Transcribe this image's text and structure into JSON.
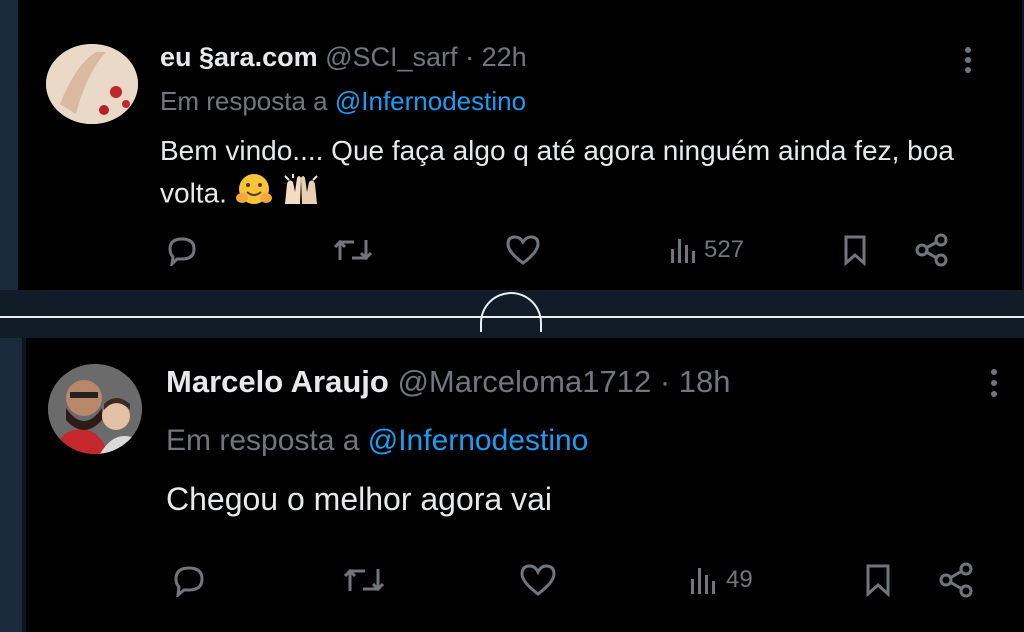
{
  "tweets": [
    {
      "display_name": "eu §ara.com",
      "handle": "@SCI_sarf",
      "separator": "·",
      "time": "22h",
      "reply_prefix": "Em resposta a",
      "reply_mention": "@Infernodestino",
      "text": "Bem vindo.... Que faça algo q até agora ninguém ainda fez, boa volta.",
      "views": "527",
      "icons": [
        "more-icon",
        "reply-icon",
        "retweet-icon",
        "like-icon",
        "views-icon",
        "bookmark-icon",
        "share-icon"
      ],
      "emojis": [
        "hugging-face-emoji",
        "raised-hands-emoji"
      ]
    },
    {
      "display_name": "Marcelo Araujo",
      "handle": "@Marceloma1712",
      "separator": "·",
      "time": "18h",
      "reply_prefix": "Em resposta a",
      "reply_mention": "@Infernodestino",
      "text": "Chegou o melhor agora vai",
      "views": "49",
      "icons": [
        "more-icon",
        "reply-icon",
        "retweet-icon",
        "like-icon",
        "views-icon",
        "bookmark-icon",
        "share-icon"
      ]
    }
  ],
  "colors": {
    "background": "#000000",
    "text_primary": "#e7e9ea",
    "text_secondary": "#71767b",
    "accent": "#1d9bf0"
  }
}
